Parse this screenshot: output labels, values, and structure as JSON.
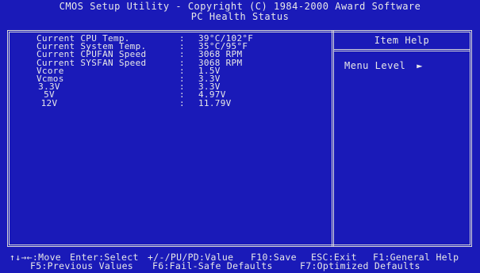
{
  "header": {
    "line1": "CMOS Setup Utility - Copyright (C) 1984-2000 Award Software",
    "line2": "PC Health Status"
  },
  "health_items": [
    {
      "label": "Current CPU Temp.",
      "value": "39°C/102°F"
    },
    {
      "label": "Current System Temp.",
      "value": "35°C/95°F"
    },
    {
      "label": "Current CPUFAN Speed",
      "value": "3068 RPM"
    },
    {
      "label": "Current SYSFAN Speed",
      "value": "3068 RPM"
    },
    {
      "label": "Vcore",
      "value": "1.5V"
    },
    {
      "label": "Vcmos",
      "value": "3.3V"
    },
    {
      "label": "3.3V",
      "value": "3.3V"
    },
    {
      "label": "5V",
      "value": "4.97V"
    },
    {
      "label": "12V",
      "value": "11.79V"
    }
  ],
  "item_help": {
    "title": "Item Help",
    "menu_level_label": "Menu Level",
    "menu_level_marker": "►"
  },
  "footer": {
    "move": "↑↓→←:Move",
    "select": "Enter:Select",
    "value": "+/-/PU/PD:Value",
    "save": "F10:Save",
    "exit": "ESC:Exit",
    "general_help": "F1:General Help",
    "previous": "F5:Previous Values",
    "failsafe": "F6:Fail-Safe Defaults",
    "optimized": "F7:Optimized Defaults"
  }
}
